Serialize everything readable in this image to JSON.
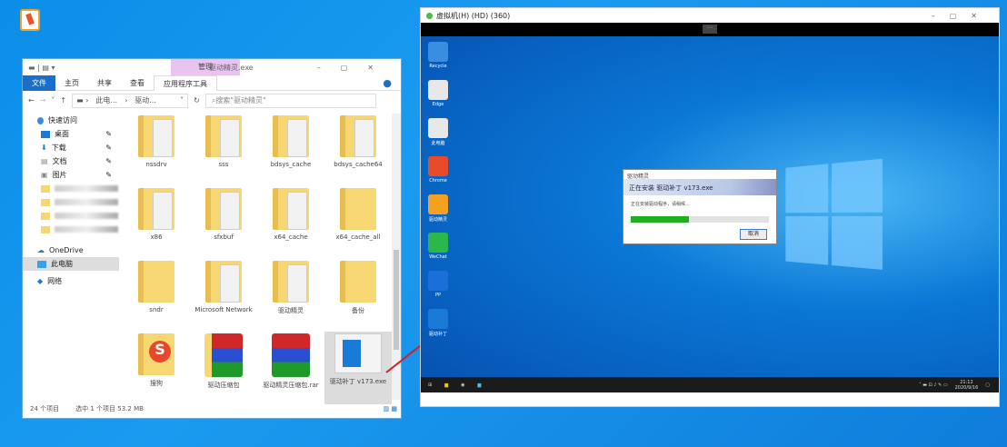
{
  "host": {
    "desktop_icon": "app-shortcut-icon"
  },
  "explorer": {
    "title": "驱动精灵.exe",
    "context_tab": "管理",
    "ribbon": [
      "文件",
      "主页",
      "共享",
      "查看",
      "应用程序工具"
    ],
    "path": [
      "此电...",
      "驱动..."
    ],
    "refresh": "↻",
    "search_placeholder": "搜索\"驱动精灵\"",
    "sidebar": [
      {
        "label": "快速访问"
      },
      {
        "label": "桌面"
      },
      {
        "label": "下载"
      },
      {
        "label": "文档"
      },
      {
        "label": "图片"
      },
      {
        "label": "OneDrive"
      },
      {
        "label": "此电脑"
      },
      {
        "label": "网络"
      }
    ],
    "files": [
      {
        "name": "nssdrv",
        "type": "folder-doc"
      },
      {
        "name": "sss",
        "type": "folder-doc"
      },
      {
        "name": "bdsys_cache",
        "type": "folder-doc"
      },
      {
        "name": "bdsys_cache64",
        "type": "folder-doc"
      },
      {
        "name": "x86",
        "type": "folder-doc"
      },
      {
        "name": "sfxbuf",
        "type": "folder-doc"
      },
      {
        "name": "x64_cache",
        "type": "folder-doc"
      },
      {
        "name": "x64_cache_all",
        "type": "folder"
      },
      {
        "name": "sndr",
        "type": "folder"
      },
      {
        "name": "Microsoft Network",
        "type": "folder-doc"
      },
      {
        "name": "驱动精灵",
        "type": "folder-doc"
      },
      {
        "name": "备份",
        "type": "folder"
      },
      {
        "name": "搜狗",
        "type": "sogou"
      },
      {
        "name": "驱动压缩包",
        "type": "rar-folder"
      },
      {
        "name": "驱动精灵压缩包.rar",
        "type": "rar"
      },
      {
        "name": "驱动补丁 v173.exe",
        "type": "exe",
        "selected": true
      }
    ],
    "status": {
      "count": "24 个项目",
      "selected": "选中 1 个项目  53.2 MB"
    }
  },
  "vm": {
    "title": "虚拟机(H) (HD) (360)",
    "toolbar_handle": "⋯",
    "desktop_icons": [
      "Recycle",
      "Edge",
      "此电脑",
      "Chrome",
      "驱动精灵",
      "WeChat",
      "PP",
      "驱动补丁"
    ],
    "dialog": {
      "title": "驱动精灵",
      "banner": "正在安装 驱动补丁 v173.exe",
      "text": "正在安装驱动程序，请稍候...",
      "progress": 0.42,
      "cancel": "取消"
    },
    "taskbar": {
      "time": "21:12",
      "date": "2020/9/16"
    }
  },
  "colors": {
    "accent": "#1a6fc8",
    "progress": "#1eb01e",
    "arrow": "#d02020"
  }
}
